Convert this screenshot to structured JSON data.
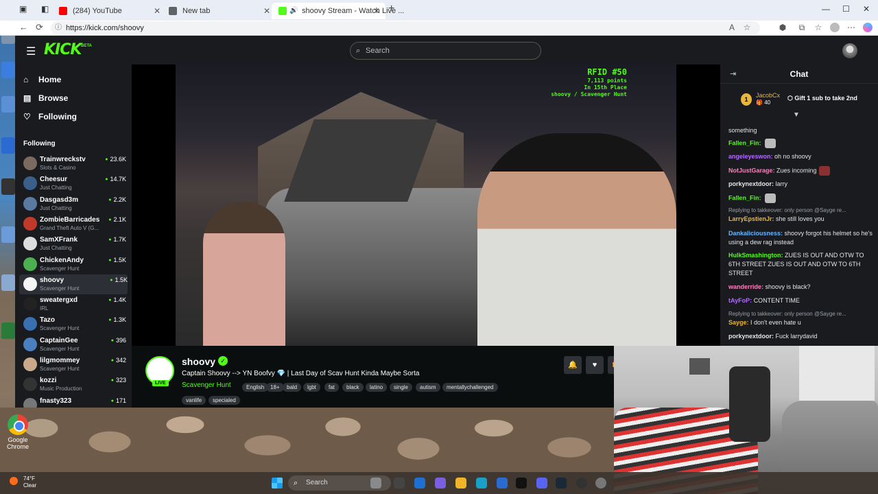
{
  "browser": {
    "tabs": [
      {
        "label": "(284) YouTube",
        "color": "#ff0000"
      },
      {
        "label": "New tab",
        "color": "#5f6368"
      },
      {
        "label": "shoovy Stream - Watch Live ...",
        "color": "#53fc18"
      }
    ],
    "url": "https://kick.com/shoovy"
  },
  "kick": {
    "logo": "KICK",
    "beta": "BETA",
    "search_placeholder": "Search",
    "nav": [
      {
        "label": "Home",
        "icon": "home-icon"
      },
      {
        "label": "Browse",
        "icon": "browse-icon"
      },
      {
        "label": "Following",
        "icon": "heart-icon"
      }
    ],
    "following_heading": "Following",
    "channels": [
      {
        "name": "Trainwreckstv",
        "game": "Slots & Casino",
        "viewers": "23.6K",
        "color": "#7a6a60"
      },
      {
        "name": "Cheesur",
        "game": "Just Chatting",
        "viewers": "14.7K",
        "color": "#3a5f8a"
      },
      {
        "name": "Dasgasd3m",
        "game": "Just Chatting",
        "viewers": "2.2K",
        "color": "#5a7aa0"
      },
      {
        "name": "ZombieBarricades",
        "game": "Grand Theft Auto V (G...",
        "viewers": "2.1K",
        "color": "#c0392b"
      },
      {
        "name": "SamXFrank",
        "game": "Just Chatting",
        "viewers": "1.7K",
        "color": "#dddddd"
      },
      {
        "name": "ChickenAndy",
        "game": "Scavenger Hunt",
        "viewers": "1.5K",
        "color": "#4caf50"
      },
      {
        "name": "shoovy",
        "game": "Scavenger Hunt",
        "viewers": "1.5K",
        "color": "#f5f5f5"
      },
      {
        "name": "sweatergxd",
        "game": "IRL",
        "viewers": "1.4K",
        "color": "#222222"
      },
      {
        "name": "Tazo",
        "game": "Scavenger Hunt",
        "viewers": "1.3K",
        "color": "#3a6fb0"
      },
      {
        "name": "CaptainGee",
        "game": "Scavenger Hunt",
        "viewers": "396",
        "color": "#4a80c0"
      },
      {
        "name": "lilgmommey",
        "game": "Scavenger Hunt",
        "viewers": "342",
        "color": "#c9a98a"
      },
      {
        "name": "kozzi",
        "game": "Music Production",
        "viewers": "323",
        "color": "#333333"
      },
      {
        "name": "fnasty323",
        "game": "",
        "viewers": "171",
        "color": "#777777"
      }
    ],
    "overlay": {
      "title": "RFID #50",
      "points": "7,113 points",
      "place": "In 15th Place",
      "info": "shoovy / Scavenger Hunt"
    },
    "stream": {
      "name": "shoovy",
      "live": "LIVE",
      "title": "Captain Shoovy --> YN Boofvy 💎 | Last Day of Scav Hunt Kinda Maybe Sorta",
      "category": "Scavenger Hunt",
      "tags": [
        "English",
        "18+",
        "bald",
        "lgbt",
        "fat",
        "black",
        "latino",
        "single",
        "autism",
        "mentallychallenged",
        "vanlife",
        "specialed"
      ],
      "gift_label": "G"
    },
    "chat": {
      "title": "Chat",
      "pinned": {
        "rank": "1",
        "user": "JacobCx",
        "count": "40",
        "message": "Gift 1 sub to take 2nd"
      },
      "messages": [
        {
          "user": "",
          "color": "#e6e6e6",
          "text": "something",
          "reply": ""
        },
        {
          "user": "Fallen_Fin:",
          "color": "#53fc18",
          "text": "",
          "reply": "",
          "emote": "#bbbbbb"
        },
        {
          "user": "angeleyeswon:",
          "color": "#b36bff",
          "text": "oh no shoovy",
          "reply": ""
        },
        {
          "user": "NotJustGarage:",
          "color": "#ff7fbf",
          "text": "Zues incoming",
          "reply": "",
          "emote": "#8a3030"
        },
        {
          "user": "porkynextdoor:",
          "color": "#e6e6e6",
          "text": "larry",
          "reply": ""
        },
        {
          "user": "Fallen_Fin:",
          "color": "#53fc18",
          "text": "",
          "reply": "",
          "emote": "#bbbbbb"
        },
        {
          "user": "LarryEpstienJr:",
          "color": "#e8b63d",
          "text": "she still loves you",
          "reply": "Replying to takkeover: only person @Sayge re..."
        },
        {
          "user": "Dankaliciousness:",
          "color": "#6bb6ff",
          "text": "shoovy forgot his helmet so he's using a dew rag instead",
          "reply": ""
        },
        {
          "user": "HulkSmashington:",
          "color": "#53fc18",
          "text": "ZUES IS OUT AND OTW TO 6TH STREET ZUES IS OUT AND OTW TO 6TH STREET",
          "reply": ""
        },
        {
          "user": "wanderride:",
          "color": "#ff7fbf",
          "text": "shoovy is black?",
          "reply": ""
        },
        {
          "user": "tAyFoP:",
          "color": "#b36bff",
          "text": "CONTENT TIME",
          "reply": ""
        },
        {
          "user": "Sayge:",
          "color": "#e8b63d",
          "text": "I don't even hate u",
          "reply": "Replying to takkeover: only person @Sayge re..."
        },
        {
          "user": "porkynextdoor:",
          "color": "#e6e6e6",
          "text": "Fuck larrydavid",
          "reply": ""
        }
      ]
    }
  },
  "taskbar": {
    "temp": "74°F",
    "weather": "Clear",
    "search": "Search"
  },
  "desktop": {
    "chrome_label": "Google Chrome"
  }
}
